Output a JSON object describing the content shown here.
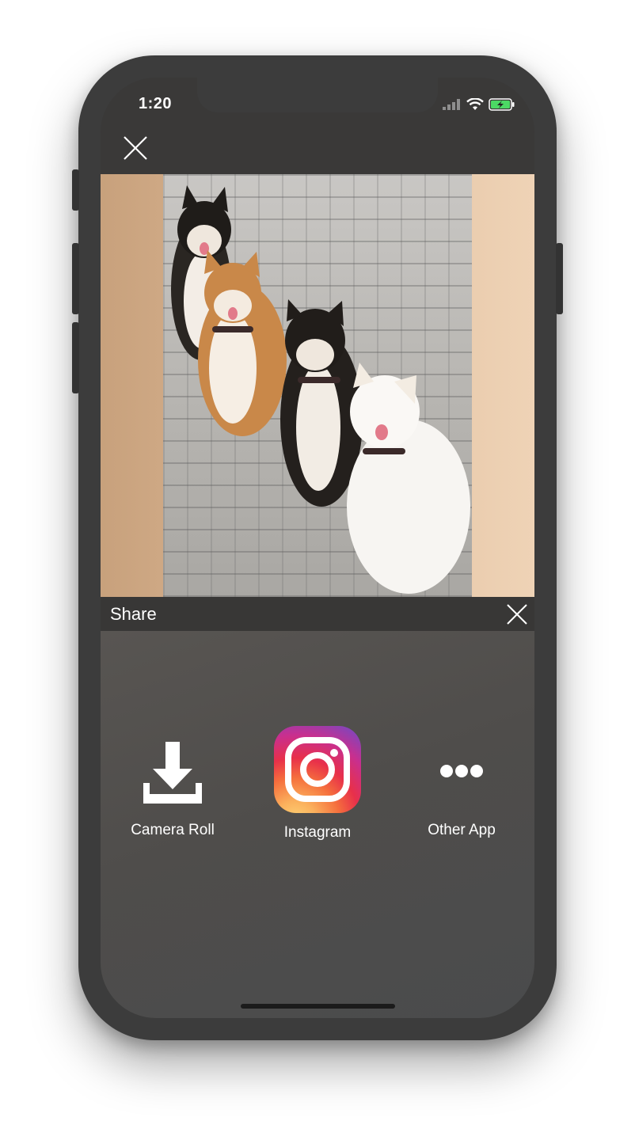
{
  "status_bar": {
    "time": "1:20"
  },
  "share": {
    "title": "Share",
    "options": [
      {
        "label": "Camera Roll",
        "icon": "download-icon"
      },
      {
        "label": "Instagram",
        "icon": "instagram-icon"
      },
      {
        "label": "Other App",
        "icon": "more-dots-icon"
      }
    ]
  },
  "colors": {
    "background": "#3a3938",
    "share_bar": "#383736",
    "text": "#ffffff",
    "battery_charging": "#4cd964"
  }
}
